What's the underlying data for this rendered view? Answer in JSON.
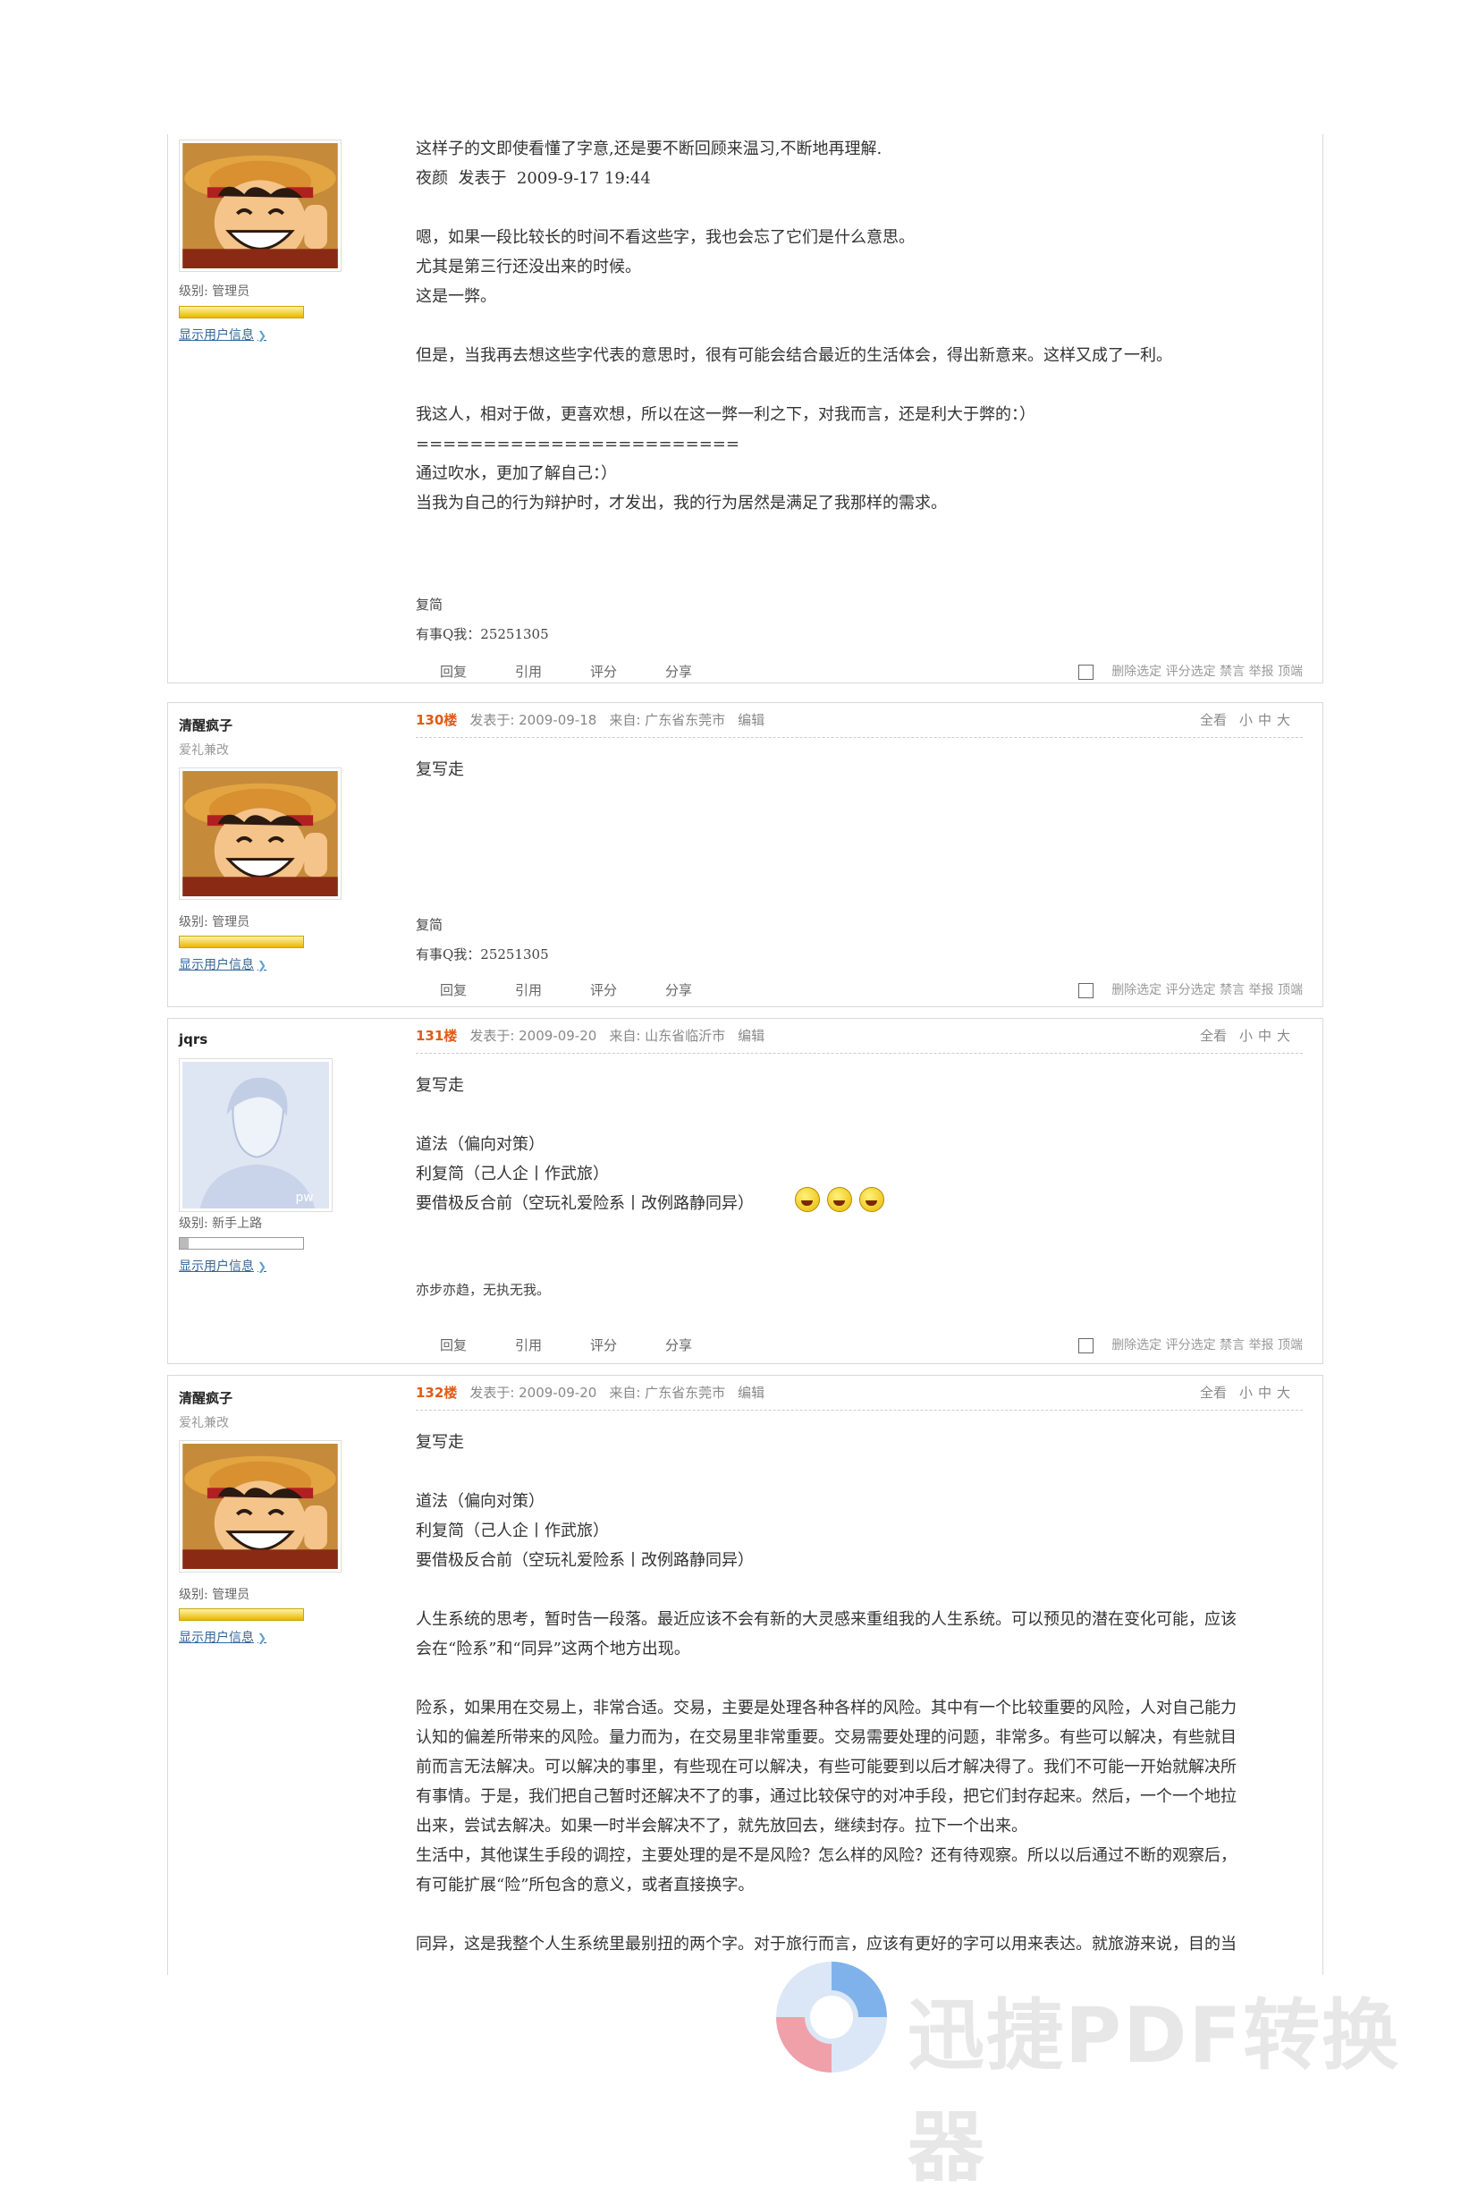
{
  "posts": [
    {
      "text": "这样子的文即使看懂了字意,还是要不断回顾来温习,不断地再理解.\n夜颜  发表于  2009-9-17 19:44\n\n嗯，如果一段比较长的时间不看这些字，我也会忘了它们是什么意思。\n尤其是第三行还没出来的时候。\n这是一弊。\n\n但是，当我再去想这些字代表的意思时，很有可能会结合最近的生活体会，得出新意来。这样又成了一利。\n\n我这人，相对于做，更喜欢想，所以在这一弊一利之下，对我而言，还是利大于弊的：）\n========================\n通过吹水，更加了解自己：）\n当我为自己的行为辩护时，才发出，我的行为居然是满足了我那样的需求。",
      "level": "级别: 管理员",
      "show_info": "显示用户信息",
      "signature": [
        "复简",
        "有事Q我：25251305"
      ]
    },
    {
      "username": "清醒疯子",
      "user_title": "爱礼兼改",
      "floor": "130楼",
      "posted": "发表于: 2009-09-18",
      "from": "来自: 广东省东莞市",
      "edit": "编辑",
      "text": "复写走",
      "level": "级别: 管理员",
      "show_info": "显示用户信息",
      "signature": [
        "复简",
        "有事Q我：25251305"
      ]
    },
    {
      "username": "jqrs",
      "floor": "131楼",
      "posted": "发表于: 2009-09-20",
      "from": "来自: 山东省临沂市",
      "edit": "编辑",
      "text": "复写走\n\n道法（偏向对策）\n利复简（己人企丨作武旅）\n要借极反合前（空玩礼爱险系丨改例路静同异）",
      "level": "级别: 新手上路",
      "show_info": "显示用户信息",
      "signature": [
        "亦步亦趋，无执无我。"
      ]
    },
    {
      "username": "清醒疯子",
      "user_title": "爱礼兼改",
      "floor": "132楼",
      "posted": "发表于: 2009-09-20",
      "from": "来自: 广东省东莞市",
      "edit": "编辑",
      "text": "复写走\n\n道法（偏向对策）\n利复简（己人企丨作武旅）\n要借极反合前（空玩礼爱险系丨改例路静同异）\n\n人生系统的思考，暂时告一段落。最近应该不会有新的大灵感来重组我的人生系统。可以预见的潜在变化可能，应该\n会在“险系”和“同异”这两个地方出现。\n\n险系，如果用在交易上，非常合适。交易，主要是处理各种各样的风险。其中有一个比较重要的风险，人对自己能力\n认知的偏差所带来的风险。量力而为，在交易里非常重要。交易需要处理的问题，非常多。有些可以解决，有些就目\n前而言无法解决。可以解决的事里，有些现在可以解决，有些可能要到以后才解决得了。我们不可能一开始就解决所\n有事情。于是，我们把自己暂时还解决不了的事，通过比较保守的对冲手段，把它们封存起来。然后，一个一个地拉\n出来，尝试去解决。如果一时半会解决不了，就先放回去，继续封存。拉下一个出来。\n生活中，其他谋生手段的调控，主要处理的是不是风险？怎么样的风险？还有待观察。所以以后通过不断的观察后，\n有可能扩展“险”所包含的意义，或者直接换字。\n\n同异，这是我整个人生系统里最别扭的两个字。对于旅行而言，应该有更好的字可以用来表达。就旅游来说，目的当",
      "level": "级别: 管理员",
      "show_info": "显示用户信息"
    }
  ],
  "header_tools": {
    "view_all": "全看",
    "sizes": [
      "小",
      "中",
      "大"
    ]
  },
  "actions": {
    "buttons": [
      "回复",
      "引用",
      "评分",
      "分享"
    ],
    "tools": [
      "删除选定",
      "评分选定",
      "禁言",
      "举报",
      "顶端"
    ]
  },
  "watermark": {
    "text": "迅捷PDF转换器"
  },
  "colors": {
    "floor": "#e05a16",
    "link": "#336699",
    "border": "#d9d9d9"
  }
}
